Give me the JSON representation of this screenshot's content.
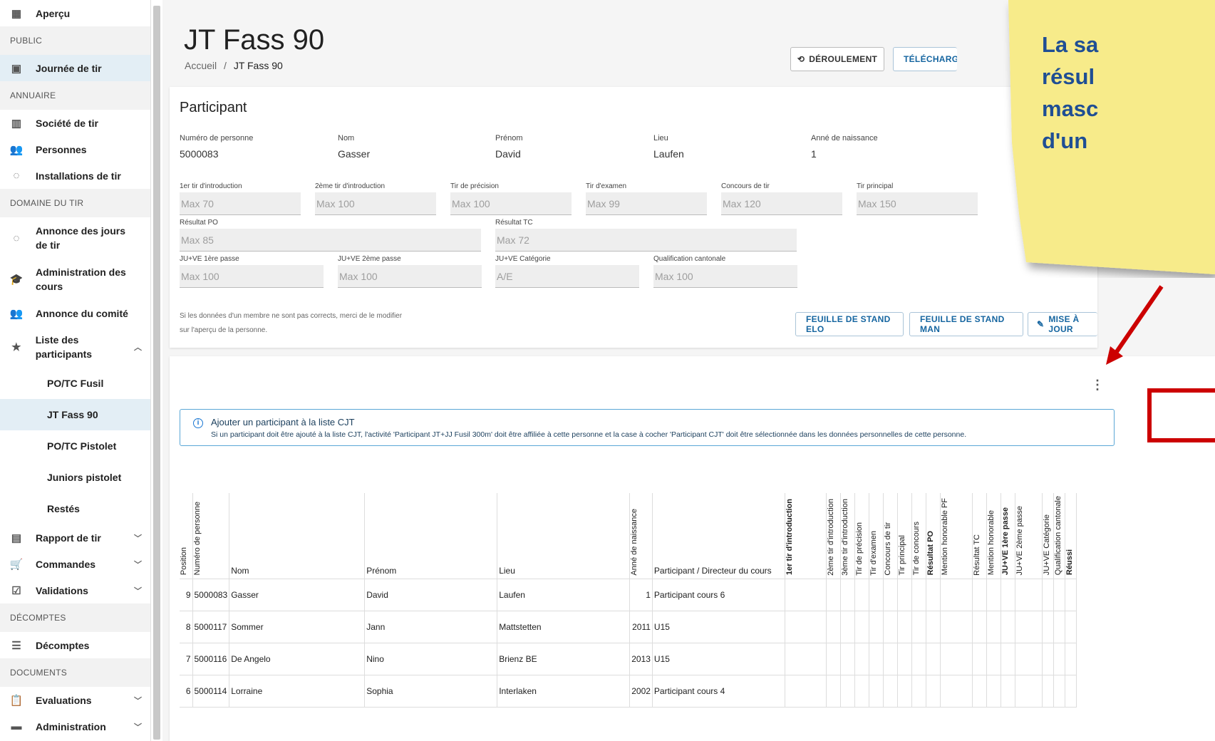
{
  "sidebar": {
    "items": [
      {
        "kind": "item",
        "label": "Aperçu",
        "icon": "dashboard-icon"
      },
      {
        "kind": "head",
        "label": "PUBLIC"
      },
      {
        "kind": "item",
        "label": "Journée de tir",
        "icon": "calendar-icon",
        "active": true
      },
      {
        "kind": "head",
        "label": "ANNUAIRE"
      },
      {
        "kind": "item",
        "label": "Société de tir",
        "icon": "building-icon"
      },
      {
        "kind": "item",
        "label": "Personnes",
        "icon": "people-icon"
      },
      {
        "kind": "item",
        "label": "Installations de tir",
        "icon": "target-icon"
      },
      {
        "kind": "head",
        "label": "DOMAINE DU TIR"
      },
      {
        "kind": "item",
        "label": "Annonce des jours de tir",
        "icon": "target-icon",
        "tall": true
      },
      {
        "kind": "item",
        "label": "Administration des cours",
        "icon": "school-icon",
        "tall": true
      },
      {
        "kind": "item",
        "label": "Annonce du comité",
        "icon": "people-icon"
      },
      {
        "kind": "item",
        "label": "Liste des participants",
        "icon": "star-icon",
        "tall": true,
        "chev": "^"
      },
      {
        "kind": "sub",
        "label": "PO/TC Fusil"
      },
      {
        "kind": "sub",
        "label": "JT Fass 90",
        "active": true
      },
      {
        "kind": "sub",
        "label": "PO/TC Pistolet"
      },
      {
        "kind": "sub",
        "label": "Juniors pistolet"
      },
      {
        "kind": "sub",
        "label": "Restés"
      },
      {
        "kind": "item",
        "label": "Rapport de tir",
        "icon": "document-icon",
        "chev": "v"
      },
      {
        "kind": "item",
        "label": "Commandes",
        "icon": "cart-icon",
        "chev": "v"
      },
      {
        "kind": "item",
        "label": "Validations",
        "icon": "check-icon",
        "chev": "v"
      },
      {
        "kind": "head",
        "label": "DÉCOMPTES"
      },
      {
        "kind": "item",
        "label": "Décomptes",
        "icon": "list-icon"
      },
      {
        "kind": "head",
        "label": "DOCUMENTS"
      },
      {
        "kind": "item",
        "label": "Evaluations",
        "icon": "clipboard-icon",
        "chev": "v"
      },
      {
        "kind": "item",
        "label": "Administration",
        "icon": "folder-icon",
        "chev": "v"
      }
    ]
  },
  "header": {
    "title": "JT Fass 90",
    "breadcrumb_home": "Accueil",
    "breadcrumb_sep": "/",
    "breadcrumb_current": "JT Fass 90",
    "btn_deroulement": "DÉROULEMENT",
    "btn_telecharger": "TÉLÉCHARGE"
  },
  "participant": {
    "title": "Participant",
    "fields": [
      {
        "label": "Numéro de personne",
        "value": "5000083"
      },
      {
        "label": "Nom",
        "value": "Gasser"
      },
      {
        "label": "Prénom",
        "value": "David"
      },
      {
        "label": "Lieu",
        "value": "Laufen"
      },
      {
        "label": "Anné de naissance",
        "value": "1"
      }
    ],
    "inputs_row1": [
      {
        "label": "1er tir d'introduction",
        "placeholder": "Max 70"
      },
      {
        "label": "2ème tir d'introduction",
        "placeholder": "Max 100"
      },
      {
        "label": "Tir de précision",
        "placeholder": "Max 100"
      },
      {
        "label": "Tir d'examen",
        "placeholder": "Max 99"
      },
      {
        "label": "Concours de tir",
        "placeholder": "Max 120"
      },
      {
        "label": "Tir principal",
        "placeholder": "Max 150"
      }
    ],
    "inputs_row2": [
      {
        "label": "Résultat PO",
        "placeholder": "Max 85"
      },
      {
        "label": "Résultat TC",
        "placeholder": "Max 72"
      }
    ],
    "inputs_row3": [
      {
        "label": "JU+VE 1ère passe",
        "placeholder": "Max 100"
      },
      {
        "label": "JU+VE 2ème passe",
        "placeholder": "Max 100"
      },
      {
        "label": "JU+VE Catégorie",
        "placeholder": "A/E"
      },
      {
        "label": "Qualification cantonale",
        "placeholder": "Max 100"
      }
    ],
    "hint_line1": "Si les données d'un membre ne sont pas corrects, merci de le modifier",
    "hint_line2": "sur l'aperçu de la personne.",
    "btn_elo": "FEUILLE DE STAND ELO",
    "btn_man": "FEUILLE DE STAND MAN",
    "btn_update": "MISE À JOUR"
  },
  "info": {
    "title": "Ajouter un participant à la liste CJT",
    "text": "Si un participant doit être ajouté à la liste CJT, l'activité 'Participant JT+JJ Fusil 300m' doit être affiliée à cette personne et la case à cocher 'Participant CJT' doit être sélectionnée dans les données personnelles de cette personne."
  },
  "more_icon": "⋮",
  "note": {
    "line1": "La sa",
    "line2": "résul",
    "line3": "masc",
    "line4": "d'un"
  },
  "table": {
    "headers": [
      "Position",
      "Numéro de personne",
      "Nom",
      "Prénom",
      "Lieu",
      "Anné de naissance",
      "Participant / Directeur du cours",
      "1er tir d'introduction",
      "2ème tir d'introduction",
      "3ème tir d'introduction",
      "Tir de précision",
      "Tir d'examen",
      "Concours de tir",
      "Tir principal",
      "Tir de concours",
      "Résultat PO",
      "Mention honorable PF",
      "Résultat TC",
      "Mention honorable",
      "JU+VE 1ère passe",
      "JU+VE 2ème passe",
      "JU+VE Catégorie",
      "Qualification cantonale",
      "Réussi"
    ],
    "rows": [
      [
        "9",
        "5000083",
        "Gasser",
        "David",
        "Laufen",
        "1",
        "Participant cours 6"
      ],
      [
        "8",
        "5000117",
        "Sommer",
        "Jann",
        "Mattstetten",
        "2011",
        "U15"
      ],
      [
        "7",
        "5000116",
        "De Angelo",
        "Nino",
        "Brienz BE",
        "2013",
        "U15"
      ],
      [
        "6",
        "5000114",
        "Lorraine",
        "Sophia",
        "Interlaken",
        "2002",
        "Participant cours 4"
      ]
    ]
  }
}
